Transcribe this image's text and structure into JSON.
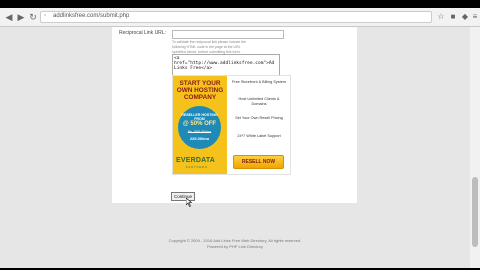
{
  "browser": {
    "url": "addlinksfree.com/submit.php",
    "icons": [
      "back-icon",
      "forward-icon",
      "reload-icon",
      "star-icon",
      "extension-icon",
      "menu-icon"
    ]
  },
  "form": {
    "reciprocal_label": "Reciprocal Link URL:",
    "hint_lines": [
      "To validate the reciprocal link please include the",
      "following HTML code in the page at the URL",
      "specified above, before submitting this form:"
    ],
    "code_text": "<a\nhref=\"http://www.addlinksfree.com\">Ad\nLinks Free</a>",
    "continue_label": "Continue"
  },
  "ad": {
    "headline": "START YOUR OWN HOSTING COMPANY",
    "reseller": "RESELLER HOSTING FROM",
    "offer": "@ 50% OFF",
    "old_price": "Rs. 555.00/mo",
    "new_price": "225.00/mo",
    "features": [
      "Free Storefront & Billing System",
      "Host Unlimited Clients & Domains",
      "Set Your Own Resell Pricing",
      "24*7 White Label Support"
    ],
    "brand": "EVERDATA",
    "brand_sub": "PARTNERS",
    "button": "RESELL NOW",
    "colors": {
      "ad_bg": "#f4c21b",
      "circle": "#1f8ab8",
      "button": "#f0a400"
    }
  },
  "footer": {
    "copyright": "Copyright © 2009 - 2016 Add Links Free Web Directory, All rights reserved.",
    "powered": "Powered by PHP Link Directory"
  }
}
